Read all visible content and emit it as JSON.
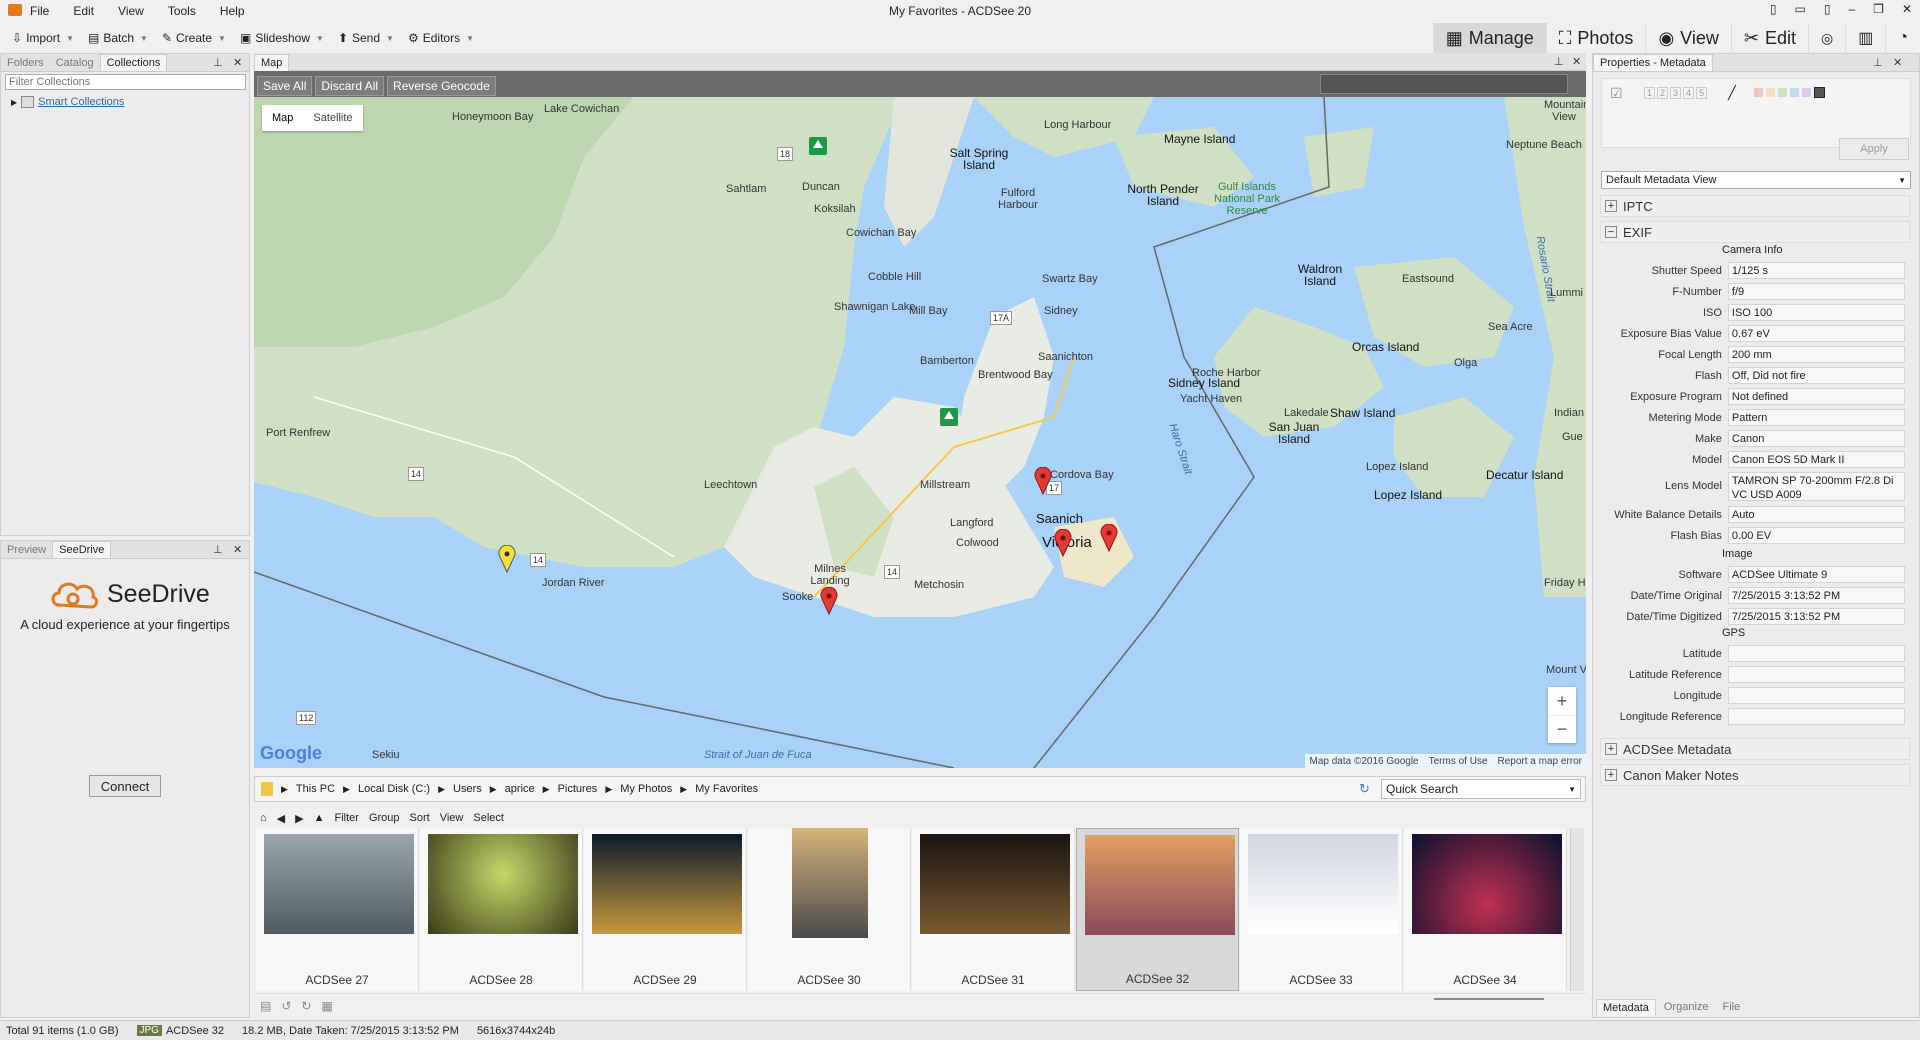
{
  "window": {
    "title": "My Favorites - ACDSee 20",
    "menu": [
      "File",
      "Edit",
      "View",
      "Tools",
      "Help"
    ]
  },
  "toolbar": {
    "items": [
      "Import",
      "Batch",
      "Create",
      "Slideshow",
      "Send",
      "Editors"
    ],
    "modes": [
      "Manage",
      "Photos",
      "View",
      "Edit"
    ]
  },
  "left": {
    "tabs": [
      "Folders",
      "Catalog",
      "Collections"
    ],
    "filter_placeholder": "Filter Collections",
    "tree_item": "Smart Collections",
    "bottom_tabs": [
      "Preview",
      "SeeDrive"
    ],
    "seedrive_title": "SeeDrive",
    "seedrive_tagline": "A cloud experience at your fingertips",
    "connect": "Connect"
  },
  "map": {
    "tab": "Map",
    "buttons": [
      "Save All",
      "Discard All",
      "Reverse Geocode"
    ],
    "types": [
      "Map",
      "Satellite"
    ],
    "attribution": [
      "Map data ©2016 Google",
      "Terms of Use",
      "Report a map error"
    ],
    "google": "Google",
    "places": [
      "Honeymoon Bay",
      "Lake Cowichan",
      "Sahtlam",
      "Duncan",
      "Koksilah",
      "Cowichan Bay",
      "Cobble Hill",
      "Shawnigan Lake",
      "Mill Bay",
      "Bamberton",
      "Brentwood Bay",
      "Saanichton",
      "Sidney",
      "Swartz Bay",
      "Long Harbour",
      "Mayne Island",
      "Salt Spring Island",
      "North Pender Island",
      "Gulf Islands National Park Reserve",
      "Fulford Harbour",
      "Waldron Island",
      "Eastsound",
      "Orcas Island",
      "Olga",
      "Sea Acre",
      "Roche Harbor",
      "Yacht Haven",
      "Lakedale",
      "San Juan Island",
      "Shaw Island",
      "Lopez Island",
      "Decatur Island",
      "Lopez Island",
      "Friday Harbor",
      "Port Renfrew",
      "Leechtown",
      "Jordan River",
      "Millstream",
      "Langford",
      "Colwood",
      "Victoria",
      "Saanich",
      "Cordova Bay",
      "Millstream",
      "Metchosin",
      "Sooke",
      "Milnes Landing",
      "Sekiu",
      "Haro Strait",
      "Rosario Strait",
      "Strait of Juan de Fuca",
      "Mountain View",
      "Neptune Beach",
      "Lummi",
      "Indian",
      "Gue",
      "Friday Harbor",
      "Sidney Island",
      "Mount Vernon",
      "Lake Cowichan"
    ],
    "routes": [
      "18",
      "17A",
      "17",
      "14",
      "14",
      "14",
      "112"
    ],
    "zoom": [
      "+",
      "−"
    ]
  },
  "browser": {
    "path": [
      "This PC",
      "Local Disk (C:)",
      "Users",
      "aprice",
      "Pictures",
      "My Photos",
      "My Favorites"
    ],
    "quick_search": "Quick Search",
    "filters": [
      "Filter",
      "Group",
      "Sort",
      "View",
      "Select"
    ],
    "thumbs": [
      "ACDSee 27",
      "ACDSee 28",
      "ACDSee 29",
      "ACDSee 30",
      "ACDSee 31",
      "ACDSee 32",
      "ACDSee 33",
      "ACDSee 34"
    ],
    "selected_index": 5
  },
  "props": {
    "title": "Properties - Metadata",
    "view": "Default Metadata View",
    "apply": "Apply",
    "rating": [
      "1",
      "2",
      "3",
      "4",
      "5"
    ],
    "sections": [
      "IPTC",
      "EXIF",
      "ACDSee Metadata",
      "Canon Maker Notes"
    ],
    "group_camera": "Camera Info",
    "group_image": "Image",
    "group_gps": "GPS",
    "exif": [
      [
        "Shutter Speed",
        "1/125 s"
      ],
      [
        "F-Number",
        "f/9"
      ],
      [
        "ISO",
        "ISO 100"
      ],
      [
        "Exposure Bias Value",
        "0.67 eV"
      ],
      [
        "Focal Length",
        "200 mm"
      ],
      [
        "Flash",
        "Off, Did not fire"
      ],
      [
        "Exposure Program",
        "Not defined"
      ],
      [
        "Metering Mode",
        "Pattern"
      ],
      [
        "Make",
        "Canon"
      ],
      [
        "Model",
        "Canon EOS 5D Mark II"
      ],
      [
        "Lens Model",
        "TAMRON SP 70-200mm F/2.8 Di VC USD A009"
      ],
      [
        "White Balance Details",
        "Auto"
      ],
      [
        "Flash Bias",
        "0.00 EV"
      ]
    ],
    "image": [
      [
        "Software",
        "ACDSee Ultimate 9"
      ],
      [
        "Date/Time Original",
        "7/25/2015 3:13:52 PM"
      ],
      [
        "Date/Time Digitized",
        "7/25/2015 3:13:52 PM"
      ]
    ],
    "gps": [
      [
        "Latitude",
        ""
      ],
      [
        "Latitude Reference",
        ""
      ],
      [
        "Longitude",
        ""
      ],
      [
        "Longitude Reference",
        ""
      ]
    ],
    "bottom_tabs": [
      "Metadata",
      "Organize",
      "File"
    ]
  },
  "status": {
    "total": "Total 91 items  (1.0 GB)",
    "type": "JPG",
    "name": "ACDSee 32",
    "info": "18.2 MB, Date Taken: 7/25/2015 3:13:52 PM",
    "dims": "5616x3744x24b"
  }
}
